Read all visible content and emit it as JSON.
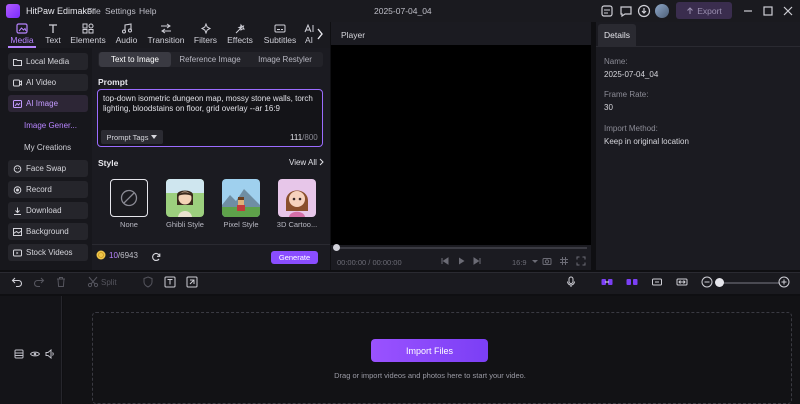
{
  "app": {
    "name": "HitPaw Edimakor",
    "menu": [
      "File",
      "Settings",
      "Help"
    ],
    "project_title": "2025-07-04_04",
    "export_label": "Export"
  },
  "toolbar": {
    "tabs": [
      {
        "label": "Media",
        "icon": "media-icon",
        "active": true
      },
      {
        "label": "Text",
        "icon": "text-icon"
      },
      {
        "label": "Elements",
        "icon": "elements-icon"
      },
      {
        "label": "Audio",
        "icon": "audio-icon"
      },
      {
        "label": "Transition",
        "icon": "transition-icon"
      },
      {
        "label": "Filters",
        "icon": "filters-icon"
      },
      {
        "label": "Effects",
        "icon": "effects-icon"
      },
      {
        "label": "Subtitles",
        "icon": "subtitles-icon"
      },
      {
        "label": "AI",
        "icon": "ai-icon"
      }
    ]
  },
  "sidebar": {
    "items": [
      {
        "label": "Local Media",
        "icon": "folder-icon"
      },
      {
        "label": "AI Video",
        "icon": "ai-video-icon"
      },
      {
        "label": "AI Image",
        "icon": "ai-image-icon",
        "active": true
      },
      {
        "label": "Image Gener...",
        "sub": true,
        "active": true
      },
      {
        "label": "My Creations",
        "sub": true
      },
      {
        "label": "Face Swap",
        "icon": "face-swap-icon"
      },
      {
        "label": "Record",
        "icon": "record-icon"
      },
      {
        "label": "Download",
        "icon": "download-icon"
      },
      {
        "label": "Background",
        "icon": "background-icon"
      },
      {
        "label": "Stock Videos",
        "icon": "stock-videos-icon"
      }
    ]
  },
  "ai_panel": {
    "tabs": [
      "Text to Image",
      "Reference Image",
      "Image Restyler"
    ],
    "active_tab": "Text to Image",
    "prompt_label": "Prompt",
    "prompt_text": "top-down isometric dungeon map, mossy stone walls, torch lighting, bloodstains on floor, grid overlay --ar 16:9",
    "prompt_tags_label": "Prompt Tags",
    "char_count": "111",
    "char_max": "/800",
    "style_label": "Style",
    "view_all": "View All",
    "styles": [
      {
        "label": "None",
        "selected": true
      },
      {
        "label": "Ghibli Style"
      },
      {
        "label": "Pixel Style"
      },
      {
        "label": "3D Cartoo..."
      }
    ],
    "credits_used": "10",
    "credits_total": "/6943",
    "generate_label": "Generate"
  },
  "player": {
    "title": "Player",
    "time": "00:00:00 / 00:00:00",
    "ratio": "16:9"
  },
  "details": {
    "tab": "Details",
    "fields": [
      {
        "label": "Name:",
        "value": "2025-07-04_04"
      },
      {
        "label": "Frame Rate:",
        "value": "30"
      },
      {
        "label": "Import Method:",
        "value": "Keep in original location"
      }
    ]
  },
  "timeline": {
    "split_label": "Split",
    "import_label": "Import Files",
    "drop_hint": "Drag or import videos and photos here to start your video."
  },
  "colors": {
    "accent": "#b784ff",
    "button": "#8a4dff",
    "bg": "#0f0f12",
    "panel": "#1b1b21"
  }
}
